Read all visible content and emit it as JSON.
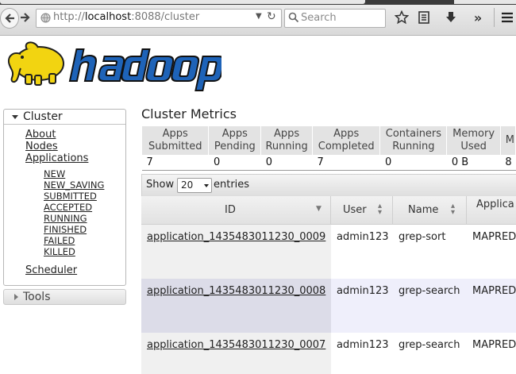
{
  "browser": {
    "url_prefix": "http://",
    "url_host": "localhost",
    "url_rest": ":8088/cluster",
    "search_placeholder": "Search"
  },
  "logo": {
    "text": "hadoop"
  },
  "sidebar": {
    "cluster_label": "Cluster",
    "links": [
      "About",
      "Nodes",
      "Applications"
    ],
    "app_states": [
      "NEW",
      "NEW_SAVING",
      "SUBMITTED",
      "ACCEPTED",
      "RUNNING",
      "FINISHED",
      "FAILED",
      "KILLED"
    ],
    "scheduler_label": "Scheduler",
    "tools_label": "Tools"
  },
  "metrics": {
    "title": "Cluster Metrics",
    "headers": [
      [
        "Apps",
        "Submitted"
      ],
      [
        "Apps",
        "Pending"
      ],
      [
        "Apps",
        "Running"
      ],
      [
        "Apps",
        "Completed"
      ],
      [
        "Containers",
        "Running"
      ],
      [
        "Memory",
        "Used"
      ],
      [
        "M",
        ""
      ]
    ],
    "values": [
      "7",
      "0",
      "0",
      "7",
      "0",
      "0 B",
      "8"
    ]
  },
  "apps": {
    "show_label": "Show",
    "page_size": "20",
    "entries_label": "entries",
    "columns": [
      "ID",
      "User",
      "Name",
      "Applica"
    ],
    "rows": [
      {
        "id": "application_1435483011230_0009",
        "user": "admin123",
        "name": "grep-sort",
        "type": "MAPRED"
      },
      {
        "id": "application_1435483011230_0008",
        "user": "admin123",
        "name": "grep-search",
        "type": "MAPRED"
      },
      {
        "id": "application_1435483011230_0007",
        "user": "admin123",
        "name": "grep-search",
        "type": "MAPRED"
      }
    ]
  },
  "colors": {
    "row_alt": "#efeffb",
    "row_id_alt": "#dcdce8",
    "row_id_normal": "#f0f0f0",
    "logo_blue": "#1e63b8",
    "logo_yellow": "#f2d411"
  }
}
